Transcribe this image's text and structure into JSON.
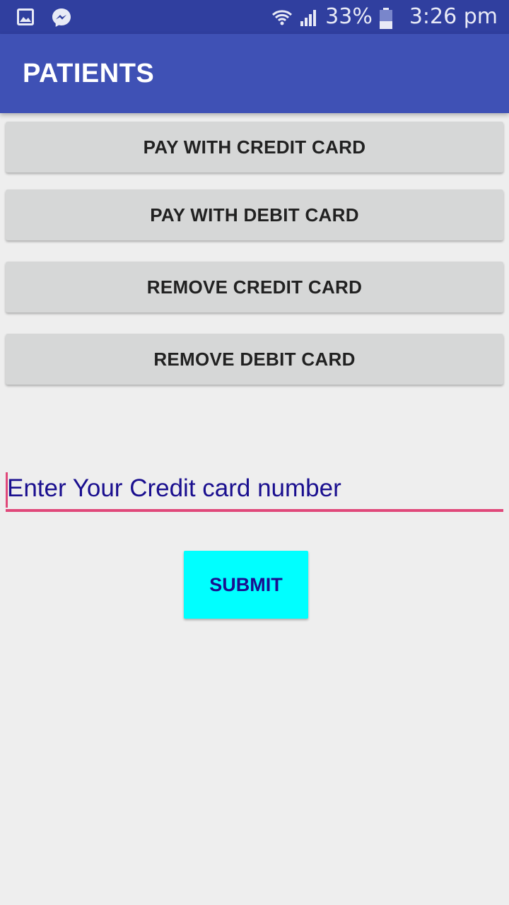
{
  "status_bar": {
    "left_icons": [
      "image-icon",
      "messenger-icon"
    ],
    "battery_percent": "33%",
    "time": "3:26 pm",
    "right_icons": [
      "wifi-icon",
      "signal-icon",
      "battery-icon"
    ]
  },
  "app_bar": {
    "title": "PATIENTS"
  },
  "actions": {
    "pay_credit": "PAY WITH CREDIT CARD",
    "pay_debit": "PAY WITH DEBIT CARD",
    "remove_credit": "REMOVE CREDIT CARD",
    "remove_debit": "REMOVE DEBIT CARD"
  },
  "form": {
    "card_input_placeholder": "Enter Your Credit card number",
    "card_input_value": "",
    "submit_label": "SUBMIT"
  },
  "colors": {
    "status_bar": "#303f9f",
    "app_bar": "#3f51b5",
    "background": "#eeeeee",
    "button": "#d6d7d7",
    "accent": "#e0487a",
    "submit": "#00ffff",
    "input_text": "#1a0f8f"
  }
}
